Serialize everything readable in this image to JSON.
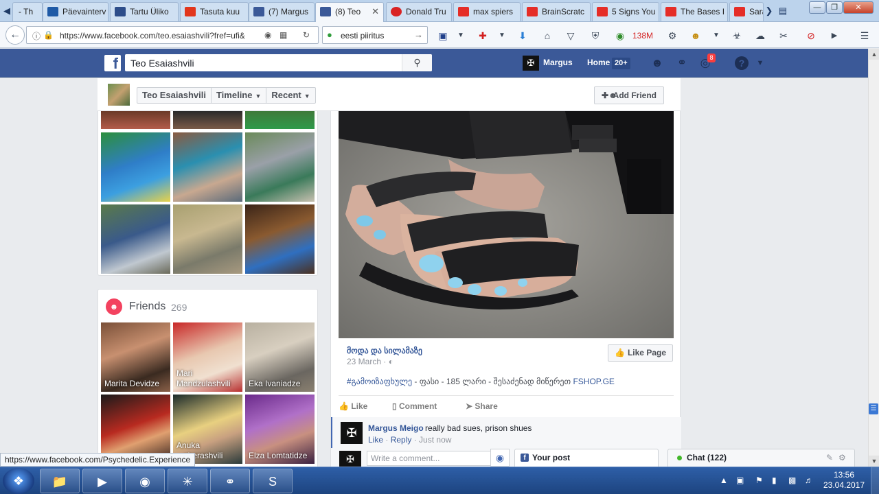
{
  "browser": {
    "tabs": [
      {
        "label": "- Th",
        "color": "#888888"
      },
      {
        "label": "Päevainterv",
        "color": "#1f5aa6"
      },
      {
        "label": "Tartu Üliko",
        "color": "#2d4d8a"
      },
      {
        "label": "Tasuta kuu",
        "color": "#e2361c"
      },
      {
        "label": "(7) Margus",
        "color": "#3b5998"
      },
      {
        "label": "(8) Teo",
        "color": "#3b5998"
      },
      {
        "label": "Donald Tru",
        "color": "#d92323"
      },
      {
        "label": "max spiers",
        "color": "#e52d27"
      },
      {
        "label": "BrainScratc",
        "color": "#e52d27"
      },
      {
        "label": "5 Signs You",
        "color": "#e52d27"
      },
      {
        "label": "The Bases I",
        "color": "#e52d27"
      },
      {
        "label": "Sara",
        "color": "#e52d27"
      }
    ],
    "url": "https://www.facebook.com/teo.esaiashvili?fref=ufi&",
    "search_value": "eesti  piiritus",
    "m_counter": "138M",
    "status_url": "https://www.facebook.com/Psychedelic.Experience"
  },
  "fb": {
    "search_value": "Teo Esaiashvili",
    "user_name": "Margus",
    "home_label": "Home",
    "home_badge": "20+",
    "notif_count": "8"
  },
  "timeline": {
    "name": "Teo Esaiashvili",
    "tab_timeline": "Timeline",
    "tab_recent": "Recent",
    "add_friend": "Add Friend"
  },
  "friends": {
    "heading": "Friends",
    "count": "269",
    "items": [
      {
        "name": "Marita Devidze"
      },
      {
        "name": "Mari Mandzulashvili"
      },
      {
        "name": "Eka Ivaniadze"
      },
      {
        "name": ""
      },
      {
        "name": "Anuka ...aberashvili"
      },
      {
        "name": "Elza Lomtatidze"
      }
    ]
  },
  "post": {
    "page_name": "მოდა და სილამაზე",
    "date": "23 March",
    "like_page": "Like Page",
    "text_tag": "#გამოიზაფხულე",
    "text_body": " - ფასი - 185 ლარი - შესაძენად მიწერეთ ",
    "text_link": "FSHOP.GE",
    "action_like": "Like",
    "action_comment": "Comment",
    "action_share": "Share"
  },
  "comment": {
    "author": "Margus Meigo",
    "text": "really bad sues, prison shues",
    "like": "Like",
    "reply": "Reply",
    "time": "Just now",
    "write_placeholder": "Write a comment..."
  },
  "dock": {
    "your_post": "Your post",
    "chat": "Chat (122)"
  },
  "taskbar": {
    "time": "13:56",
    "date": "23.04.2017"
  }
}
